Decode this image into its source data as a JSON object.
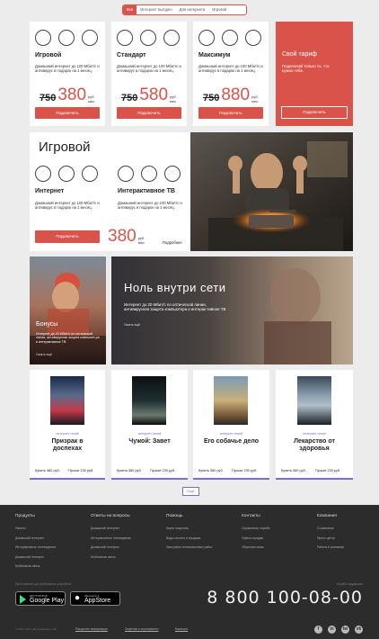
{
  "tabs": [
    "Все",
    "Интернет выгоден",
    "Для интернета",
    "Игровой"
  ],
  "plans": [
    {
      "name": "Игровой",
      "desc": "Домашний интернет до 100 Мбит/с и антивирус в подарок на 1 месяц.",
      "old": "750",
      "new": "380",
      "unit1": "руб.",
      "unit2": "мес.",
      "btn": "Подключить"
    },
    {
      "name": "Стандарт",
      "desc": "Домашний интернет до 100 Мбит/с и антивирус в подарок на 1 месяц.",
      "old": "750",
      "new": "580",
      "unit1": "руб.",
      "unit2": "мес.",
      "btn": "Подключить"
    },
    {
      "name": "Максимум",
      "desc": "Домашний интернет до 100 Мбит/с и антивирус в подарок на 1 месяц.",
      "old": "750",
      "new": "880",
      "unit1": "руб.",
      "unit2": "мес.",
      "btn": "Подключить"
    }
  ],
  "own_plan": {
    "title": "Свой тариф",
    "desc": "Подключай только то, что нужно тебе.",
    "btn": "Подключить"
  },
  "game": {
    "title": "Игровой",
    "items": [
      {
        "name": "Интернет",
        "desc": "Домашний интернет до 100 Мбит/с и антивирус в подарок на 1 месяц."
      },
      {
        "name": "Интерактивное ТВ",
        "desc": "Домашний интернет до 100 Мбит/с и антивирус в подарок на 1 месяц."
      }
    ],
    "btn": "Подключить",
    "price": "380",
    "unit1": "руб.",
    "unit2": "мес.",
    "more": "Подробнее"
  },
  "bonus": {
    "title": "Бонусы",
    "desc": "Интернет до 20 Мбит/с по оптической линии, антивирусная защита компьюте-ра и интерактивное ТВ",
    "link": "Узнать ещё"
  },
  "zero": {
    "title": "Ноль внутри сети",
    "desc": "Интернет до 20 Мбит/с по оптической линии, антивирусная защита компьютера и интерак-тивное ТВ",
    "link": "Узнать ещё"
  },
  "movies": [
    {
      "tag": "интернет гений",
      "title": "Призрак в доспехах",
      "buy": "Купить 380 руб.",
      "rent": "Прокат 230 руб."
    },
    {
      "tag": "интернет гений",
      "title": "Чужой: Завет",
      "buy": "Купить 380 руб.",
      "rent": "Прокат 230 руб."
    },
    {
      "tag": "интернет гений",
      "title": "Его собачье дело",
      "buy": "Купить 380 руб.",
      "rent": "Прокат 230 руб."
    },
    {
      "tag": "интернет гений",
      "title": "Лекарство от здоровья",
      "buy": "Купить 380 руб.",
      "rent": "Прокат 230 руб."
    }
  ],
  "more_btn": "Ещё",
  "footer": {
    "columns": [
      {
        "title": "Продукты",
        "links": [
          "Пакеты",
          "Домашний интернет",
          "Интерактивное телевидение",
          "Домашний телефон",
          "Мобильная связь"
        ]
      },
      {
        "title": "Ответы на вопросы",
        "links": [
          "Домашний интернет",
          "Интерактивное телевидение",
          "Домашний телефон",
          "Мобильная связь"
        ]
      },
      {
        "title": "Помощь",
        "links": [
          "Карта покрытия",
          "Виды оплаты и продажа",
          "Настройка телевизионных работ"
        ]
      },
      {
        "title": "Контакты",
        "links": [
          "Справочная служба",
          "Офисы продаж",
          "Обратная связь"
        ]
      },
      {
        "title": "Компания",
        "links": [
          "О компании",
          "Пресс-центр",
          "Работа в компании"
        ]
      }
    ],
    "apps_label": "Приложение для мобильных устройств",
    "support_label": "служба поддержки",
    "google_small": "ДОСТУПНО В",
    "google_big": "Google Play",
    "apple_small": "Загрузите в",
    "apple_big": "AppStore",
    "phone": "8 800 100-08-00",
    "copyright": "© 2017 ООО «Интерзнание», 18+",
    "bottom_links": [
      "Раскрытие информации",
      "Лицензии и сертификаты",
      "Вакансии"
    ],
    "social": [
      "f",
      "in",
      "tw",
      "vk"
    ],
    "colors": {
      "accent": "#d9534a",
      "purple": "#7b6bd6",
      "footer_bg": "#2c2c2c"
    }
  }
}
